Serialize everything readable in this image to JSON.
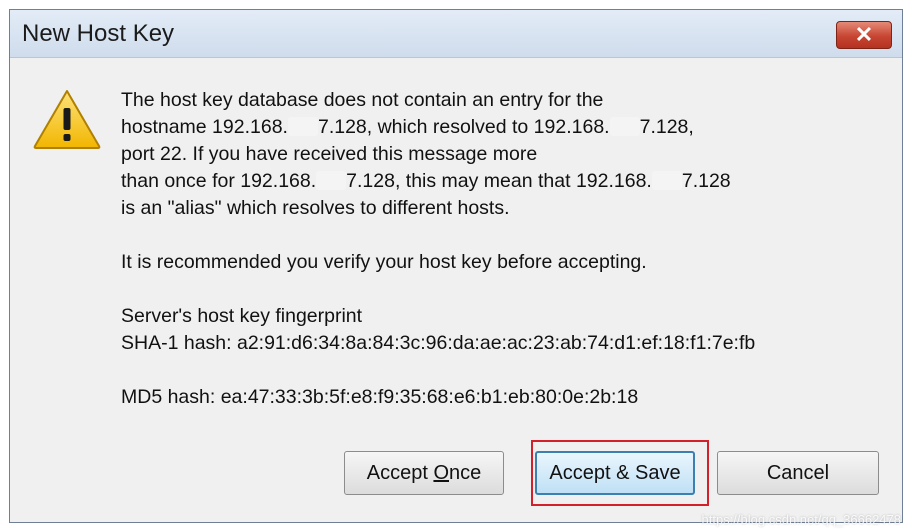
{
  "window": {
    "title": "New Host Key",
    "close_label": "✕"
  },
  "message": {
    "p1": {
      "a": "The host key database does not contain an entry for the",
      "b1": "hostname 192.168.",
      "b2": "7.128, which resolved to 192.168.",
      "b3": "7.128,",
      "c": "port 22.  If you have received this message more",
      "d1": "than once for 192.168.",
      "d2": "7.128, this may mean that 192.168.",
      "d3": "7.128",
      "e": "is an \"alias\" which resolves to different hosts."
    },
    "p2": "It is recommended you verify your host key before accepting.",
    "p3": {
      "heading": "Server's host key fingerprint",
      "sha1": "SHA-1 hash: a2:91:d6:34:8a:84:3c:96:da:ae:ac:23:ab:74:d1:ef:18:f1:7e:fb"
    },
    "p4": "MD5 hash: ea:47:33:3b:5f:e8:f9:35:68:e6:b1:eb:80:0e:2b:18"
  },
  "buttons": {
    "accept_once_pre": "Accept ",
    "accept_once_ul": "O",
    "accept_once_post": "nce",
    "accept_save": "Accept & Save",
    "cancel": "Cancel"
  },
  "watermark": "https://blog.csdn.net/qq_36662478",
  "colors": {
    "highlight": "#d2212a",
    "close_button": "#c74633",
    "title_bar": "#d8e4f2"
  },
  "icons": {
    "warning": "warning-icon",
    "close": "close-icon"
  }
}
